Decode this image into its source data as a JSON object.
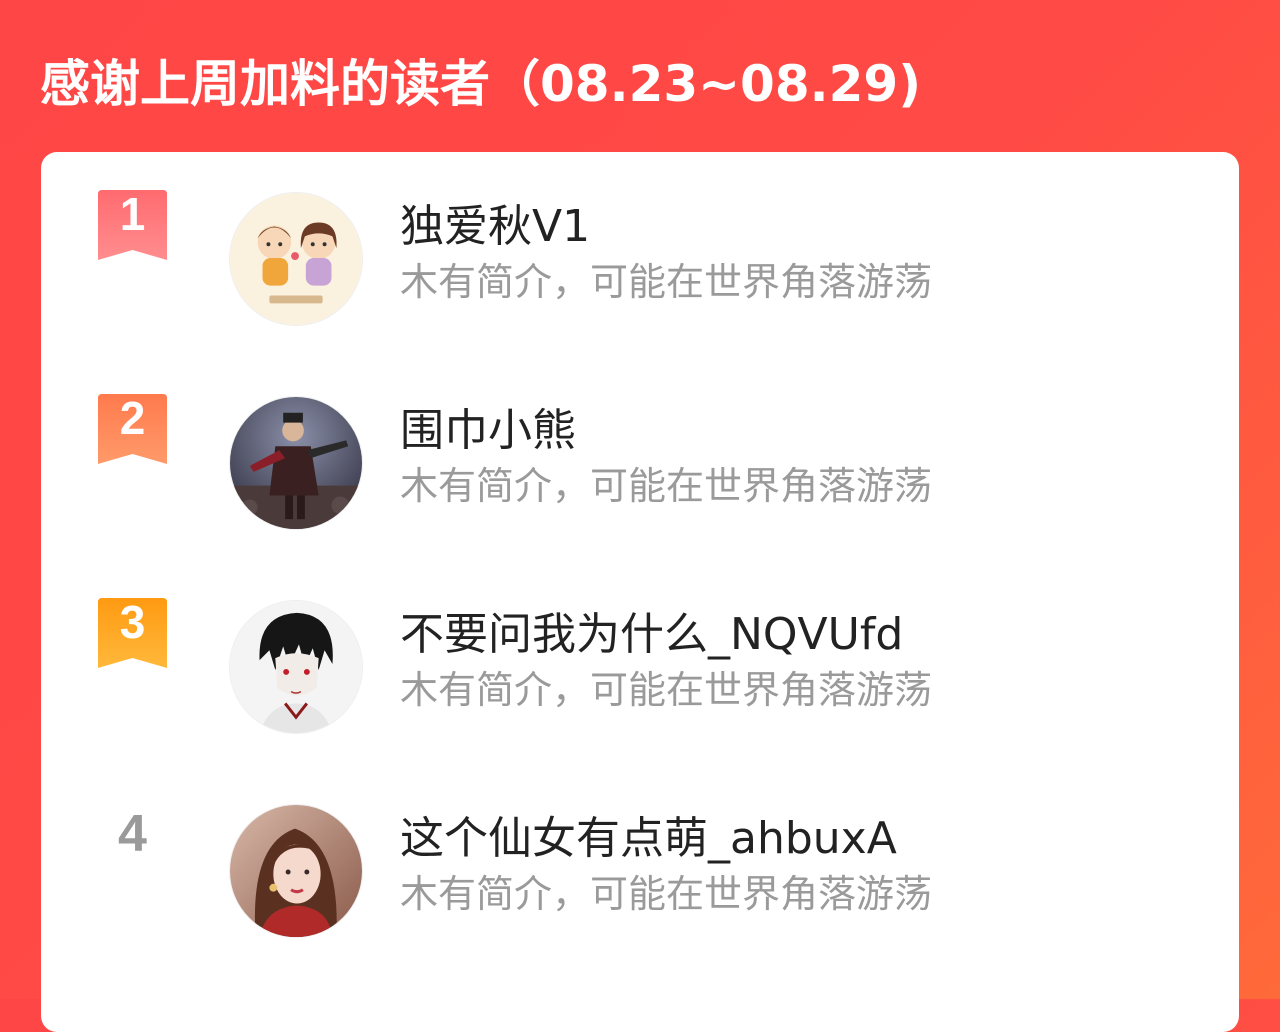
{
  "header": {
    "title": "感谢上周加料的读者（08.23~08.29)"
  },
  "colors": {
    "background_start": "#ff4646",
    "background_end": "#ff6a3a",
    "rank1": "#ff5a5f",
    "rank2": "#ff7f50",
    "rank3": "#ffa31a",
    "rank_plain": "#9a9a9a"
  },
  "readers": [
    {
      "rank": "1",
      "name": "独爱秋V1",
      "bio": "木有简介，可能在世界角落游荡",
      "avatar_icon": "cartoon-couple-avatar"
    },
    {
      "rank": "2",
      "name": "围巾小熊",
      "bio": "木有简介，可能在世界角落游荡",
      "avatar_icon": "game-warrior-avatar"
    },
    {
      "rank": "3",
      "name": "不要问我为什么_NQVUfd",
      "bio": "木有简介，可能在世界角落游荡",
      "avatar_icon": "anime-boy-avatar"
    },
    {
      "rank": "4",
      "name": "这个仙女有点萌_ahbuxA",
      "bio": "木有简介，可能在世界角落游荡",
      "avatar_icon": "girl-portrait-avatar"
    }
  ]
}
